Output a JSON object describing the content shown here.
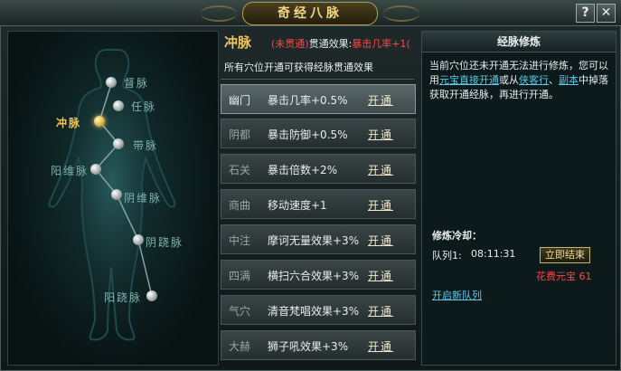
{
  "window": {
    "title": "奇经八脉",
    "help_label": "?",
    "close_label": "✕"
  },
  "body_map": {
    "meridians": [
      {
        "label": "督脉",
        "selected": false
      },
      {
        "label": "任脉",
        "selected": false
      },
      {
        "label": "冲脉",
        "selected": true
      },
      {
        "label": "带脉",
        "selected": false
      },
      {
        "label": "阳维脉",
        "selected": false
      },
      {
        "label": "阴维脉",
        "selected": false
      },
      {
        "label": "阴跷脉",
        "selected": false
      },
      {
        "label": "阳跷脉",
        "selected": false
      }
    ]
  },
  "meridian_detail": {
    "name": "冲脉",
    "status": "(未贯通)",
    "effect_label": "贯通效果:",
    "effect_value": "暴击几率+1(",
    "description": "所有穴位开通可获得经脉贯通效果",
    "open_label": "开通",
    "acupoints": [
      {
        "name": "幽门",
        "effect": "暴击几率+0.5%",
        "selected": true
      },
      {
        "name": "阴都",
        "effect": "暴击防御+0.5%",
        "selected": false
      },
      {
        "name": "石关",
        "effect": "暴击倍数+2%",
        "selected": false
      },
      {
        "name": "商曲",
        "effect": "移动速度+1",
        "selected": false
      },
      {
        "name": "中注",
        "effect": "摩诃无量效果+3%",
        "selected": false
      },
      {
        "name": "四满",
        "effect": "横扫六合效果+3%",
        "selected": false
      },
      {
        "name": "气穴",
        "effect": "清音梵唱效果+3%",
        "selected": false
      },
      {
        "name": "大赫",
        "effect": "狮子吼效果+3%",
        "selected": false
      }
    ]
  },
  "cultivation": {
    "header": "经脉修炼",
    "text_1": "当前穴位还未开通无法进行修炼，您可以用",
    "link_1": "元宝直接开通",
    "text_2": "或从",
    "link_2": "侠客行",
    "text_3": "、",
    "link_3": "副本",
    "text_4": "中掉落获取开通经脉，再进行开通。",
    "cooldown_title": "修炼冷却：",
    "queue_label": "队列1:",
    "queue_time": "08:11:31",
    "finish_button": "立即结束",
    "cost_label": "花费元宝",
    "cost_value": "61",
    "new_queue_link": "开启新队列"
  },
  "colors": {
    "accent_gold": "#f2c45a",
    "status_red": "#ff4444",
    "link_cyan": "#5ec8e6"
  }
}
